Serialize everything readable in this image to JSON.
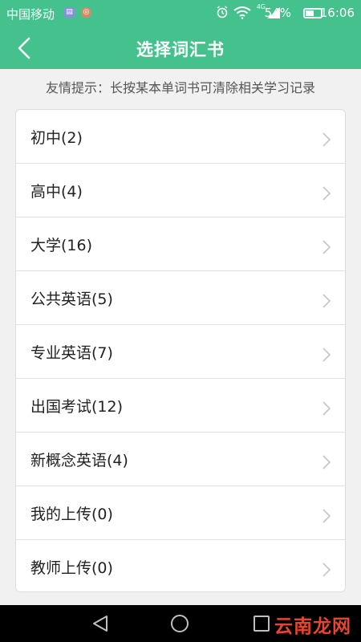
{
  "status_bar": {
    "carrier": "中国移动",
    "network": "4G",
    "battery": "54%",
    "battery_level": 0.54,
    "time": "16:06"
  },
  "header": {
    "back_icon": "chevron-left-icon",
    "title": "选择词汇书"
  },
  "tip": "友情提示：长按某本单词书可清除相关学习记录",
  "books": [
    {
      "label": "初中(2)"
    },
    {
      "label": "高中(4)"
    },
    {
      "label": "大学(16)"
    },
    {
      "label": "公共英语(5)"
    },
    {
      "label": "专业英语(7)"
    },
    {
      "label": "出国考试(12)"
    },
    {
      "label": "新概念英语(4)"
    },
    {
      "label": "我的上传(0)"
    },
    {
      "label": "教师上传(0)"
    }
  ],
  "watermark": "云南龙网",
  "colors": {
    "accent": "#45c18e",
    "background": "#f1f1f1",
    "watermark": "#e8452e"
  }
}
